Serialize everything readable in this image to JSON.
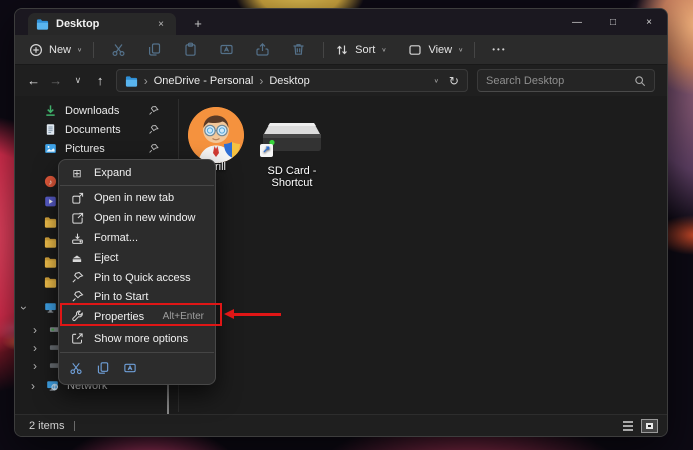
{
  "colors": {
    "annotation_red": "#e01616",
    "menu_bg": "#2c2c2c",
    "folder_yellow": "#f3c14b",
    "icon_blue": "#3fa3e8",
    "toolbar_disabled_icon": "#54718a"
  },
  "titlebar": {
    "tab_title": "Desktop"
  },
  "icons": {
    "tab_close": "×",
    "new_tab": "+",
    "minimize": "—",
    "maximize": "□",
    "close": "×",
    "back": "←",
    "forward": "→",
    "dropdown": "∨",
    "up": "↑",
    "refresh": "↻",
    "breadcrumb_sep": "›",
    "more": "•••",
    "music_note": "♪",
    "play": "▶",
    "chevron": "›",
    "shortcut_arrow": "↗",
    "expand": "⊞",
    "eject": "⏏"
  },
  "toolbar": {
    "new_label": "New",
    "sort_label": "Sort",
    "view_label": "View"
  },
  "navbar": {
    "breadcrumb_root": "OneDrive - Personal",
    "breadcrumb_current": "Desktop",
    "search_placeholder": "Search Desktop"
  },
  "sidebar": {
    "items": [
      {
        "label": "Downloads"
      },
      {
        "label": "Documents"
      },
      {
        "label": "Pictures"
      }
    ],
    "network_label": "Network"
  },
  "context_menu": {
    "items": [
      {
        "label": "Expand"
      },
      {
        "label": "Open in new tab"
      },
      {
        "label": "Open in new window"
      },
      {
        "label": "Format..."
      },
      {
        "label": "Eject"
      },
      {
        "label": "Pin to Quick access"
      },
      {
        "label": "Pin to Start"
      },
      {
        "label": "Properties",
        "shortcut": "Alt+Enter"
      },
      {
        "label": "Show more options"
      }
    ]
  },
  "files": [
    {
      "label_visible": "rill"
    },
    {
      "label_line1": "SD Card -",
      "label_line2": "Shortcut"
    }
  ],
  "statusbar": {
    "count": "2 items"
  }
}
